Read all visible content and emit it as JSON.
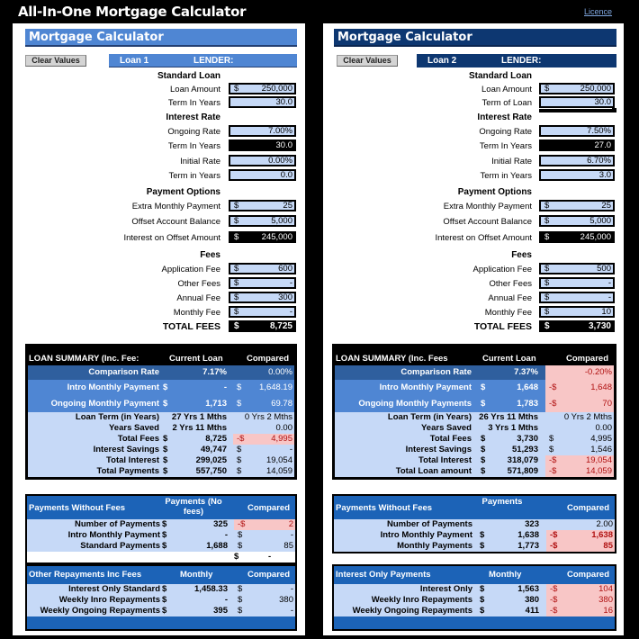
{
  "app": {
    "title": "All-In-One Mortgage Calculator",
    "licence_link": "Licence"
  },
  "panels": [
    {
      "header": "Mortgage Calculator",
      "clear_button": "Clear Values",
      "loan_name": "Loan 1",
      "lender_label": "LENDER:",
      "standard_loan": {
        "title": "Standard Loan",
        "loan_amount_label": "Loan Amount",
        "loan_amount": "250,000",
        "term_label": "Term In Years",
        "term": "30.0"
      },
      "interest_rate": {
        "title": "Interest Rate",
        "ongoing_label": "Ongoing Rate",
        "ongoing": "7.00%",
        "ongoing_term_label": "Term In Years",
        "ongoing_term": "30.0",
        "initial_label": "Initial Rate",
        "initial": "0.00%",
        "initial_term_label": "Term in Years",
        "initial_term": "0.0"
      },
      "payment_options": {
        "title": "Payment Options",
        "extra_label": "Extra Monthly Payment",
        "extra": "25",
        "offset_label": "Offset Account Balance",
        "offset": "5,000",
        "interest_offset_label": "Interest on Offset Amount",
        "interest_offset": "245,000"
      },
      "fees": {
        "title": "Fees",
        "application_label": "Application Fee",
        "application": "600",
        "other_label": "Other Fees",
        "other": "-",
        "annual_label": "Annual Fee",
        "annual": "300",
        "monthly_label": "Monthly Fee",
        "monthly": "-",
        "total_label": "TOTAL FEES",
        "total": "8,725"
      },
      "currency": "$",
      "summary": {
        "title": "LOAN SUMMARY (Inc. Fee:",
        "col1": "Current Loan",
        "col2": "Compared",
        "rows": [
          {
            "label": "Comparison Rate",
            "cur": "",
            "value": "7.17%",
            "cmp_cur": "",
            "cmp": "0.00%",
            "neg": false
          },
          {
            "label": "Intro Monthly Payment",
            "cur": "$",
            "value": "-",
            "cmp_cur": "$",
            "cmp": "1,648.19",
            "neg": false
          },
          {
            "label": "Ongoing Monthly Payment",
            "cur": "$",
            "value": "1,713",
            "cmp_cur": "$",
            "cmp": "69.78",
            "neg": false
          },
          {
            "label": "Loan Term (in Years)",
            "cur": "",
            "value": "27 Yrs 1 Mths",
            "cmp_cur": "",
            "cmp": "0 Yrs 2 Mths",
            "neg": false
          },
          {
            "label": "Years Saved",
            "cur": "",
            "value": "2 Yrs 11 Mths",
            "cmp_cur": "",
            "cmp": "0.00",
            "neg": false
          },
          {
            "label": "Total Fees",
            "cur": "$",
            "value": "8,725",
            "cmp_cur": "-$",
            "cmp": "4,995",
            "neg": true
          },
          {
            "label": "Interest Savings",
            "cur": "$",
            "value": "49,747",
            "cmp_cur": "$",
            "cmp": "-",
            "neg": false
          },
          {
            "label": "Total Interest",
            "cur": "$",
            "value": "299,025",
            "cmp_cur": "$",
            "cmp": "19,054",
            "neg": false
          },
          {
            "label": "Total Payments",
            "cur": "$",
            "value": "557,750",
            "cmp_cur": "$",
            "cmp": "14,059",
            "neg": false
          }
        ]
      },
      "no_fees": {
        "title": "Payments Without Fees",
        "col1": "Payments (No fees)",
        "col2": "Compared",
        "rows": [
          {
            "label": "Number of Payments",
            "cur": "$",
            "value": "325",
            "cmp_cur": "-$",
            "cmp": "2",
            "neg": true
          },
          {
            "label": "Intro Monthly Payment",
            "cur": "$",
            "value": "-",
            "cmp_cur": "$",
            "cmp": "-",
            "neg": false
          },
          {
            "label": "Standard Payments",
            "cur": "$",
            "value": "1,688",
            "cmp_cur": "$",
            "cmp": "85",
            "neg": false
          }
        ],
        "extra_cur": "$",
        "extra_val": "-"
      },
      "other": {
        "title": "Other Repayments Inc Fees",
        "col1": "Monthly",
        "col2": "Compared",
        "rows": [
          {
            "label": "Interest Only Standard",
            "cur": "$",
            "value": "1,458.33",
            "cmp_cur": "$",
            "cmp": "-",
            "neg": false
          },
          {
            "label": "Weekly Inro Repayments",
            "cur": "$",
            "value": "-",
            "cmp_cur": "$",
            "cmp": "380",
            "neg": false
          },
          {
            "label": "Weekly Ongoing Repayments",
            "cur": "$",
            "value": "395",
            "cmp_cur": "$",
            "cmp": "-",
            "neg": false
          }
        ]
      }
    },
    {
      "header": "Mortgage Calculator",
      "clear_button": "Clear Values",
      "loan_name": "Loan 2",
      "lender_label": "LENDER:",
      "standard_loan": {
        "title": "Standard Loan",
        "loan_amount_label": "Loan Amount",
        "loan_amount": "250,000",
        "term_label": "Term of Loan",
        "term": "30.0"
      },
      "interest_rate": {
        "title": "Interest Rate",
        "ongoing_label": "Ongoing Rate",
        "ongoing": "7.50%",
        "ongoing_term_label": "Term In Years",
        "ongoing_term": "27.0",
        "initial_label": "Initial Rate",
        "initial": "6.70%",
        "initial_term_label": "Term in Years",
        "initial_term": "3.0"
      },
      "payment_options": {
        "title": "Payment Options",
        "extra_label": "Extra Monthly Payment",
        "extra": "25",
        "offset_label": "Offset Account Balance",
        "offset": "5,000",
        "interest_offset_label": "Interest on Offset Amount",
        "interest_offset": "245,000"
      },
      "fees": {
        "title": "Fees",
        "application_label": "Application Fee",
        "application": "500",
        "other_label": "Other Fees",
        "other": "-",
        "annual_label": "Annual Fee",
        "annual": "-",
        "monthly_label": "Monthly Fee",
        "monthly": "10",
        "total_label": "TOTAL FEES",
        "total": "3,730"
      },
      "currency": "$",
      "summary": {
        "title": "LOAN SUMMARY (Inc. Fees",
        "col1": "Current Loan",
        "col2": "Compared",
        "rows": [
          {
            "label": "Comparison Rate",
            "cur": "",
            "value": "7.37%",
            "cmp_cur": "",
            "cmp": "-0.20%",
            "neg": true
          },
          {
            "label": "Intro Monthly Payment",
            "cur": "$",
            "value": "1,648",
            "cmp_cur": "-$",
            "cmp": "1,648",
            "neg": true
          },
          {
            "label": "Ongoing Monthly Payments",
            "cur": "$",
            "value": "1,783",
            "cmp_cur": "-$",
            "cmp": "70",
            "neg": true
          },
          {
            "label": "Loan Term (in Years)",
            "cur": "",
            "value": "26 Yrs 11 Mths",
            "cmp_cur": "",
            "cmp": "0 Yrs 2 Mths",
            "neg": false
          },
          {
            "label": "Years Saved",
            "cur": "",
            "value": "3 Yrs 1 Mths",
            "cmp_cur": "",
            "cmp": "0.00",
            "neg": false
          },
          {
            "label": "Total Fees",
            "cur": "$",
            "value": "3,730",
            "cmp_cur": "$",
            "cmp": "4,995",
            "neg": false
          },
          {
            "label": "Interest Savings",
            "cur": "$",
            "value": "51,293",
            "cmp_cur": "$",
            "cmp": "1,546",
            "neg": false
          },
          {
            "label": "Total Interest",
            "cur": "$",
            "value": "318,079",
            "cmp_cur": "-$",
            "cmp": "19,054",
            "neg": true
          },
          {
            "label": "Total Loan amount",
            "cur": "$",
            "value": "571,809",
            "cmp_cur": "-$",
            "cmp": "14,059",
            "neg": true
          }
        ]
      },
      "no_fees": {
        "title": "Payments Without Fees",
        "col1": "Payments",
        "col2": "Compared",
        "rows": [
          {
            "label": "Number of Payments",
            "cur": "",
            "value": "323",
            "cmp_cur": "",
            "cmp": "2.00",
            "neg": false
          },
          {
            "label": "Intro Monthly Payment",
            "cur": "$",
            "value": "1,638",
            "cmp_cur": "-$",
            "cmp": "1,638",
            "neg": true,
            "bold": true
          },
          {
            "label": "Monthly Payments",
            "cur": "$",
            "value": "1,773",
            "cmp_cur": "-$",
            "cmp": "85",
            "neg": true,
            "bold": true
          }
        ]
      },
      "other": {
        "title": "Interest Only Payments",
        "col1": "Monthly",
        "col2": "Compared",
        "rows": [
          {
            "label": "Interest Only",
            "cur": "$",
            "value": "1,563",
            "cmp_cur": "-$",
            "cmp": "104",
            "neg": true
          },
          {
            "label": "Weekly Inro Repayments",
            "cur": "$",
            "value": "380",
            "cmp_cur": "-$",
            "cmp": "380",
            "neg": true
          },
          {
            "label": "Weekly Ongoing Repayments",
            "cur": "$",
            "value": "411",
            "cmp_cur": "-$",
            "cmp": "16",
            "neg": true
          }
        ]
      }
    }
  ]
}
